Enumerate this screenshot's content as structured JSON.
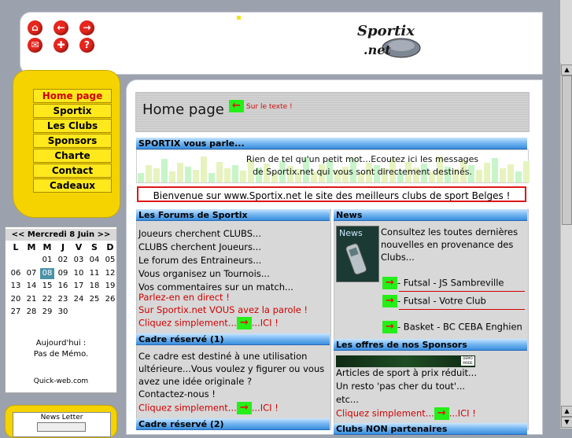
{
  "header": {
    "nav_icons": [
      {
        "name": "home-icon",
        "color": "#e8261d",
        "glyph": "⌂"
      },
      {
        "name": "back-arrow-icon",
        "color": "#e8261d",
        "glyph": "←"
      },
      {
        "name": "forward-arrow-icon",
        "color": "#e8261d",
        "glyph": "→"
      },
      {
        "name": "mail-icon",
        "color": "#e8261d",
        "glyph": "✉"
      },
      {
        "name": "gift-icon",
        "color": "#e8261d",
        "glyph": "✚"
      },
      {
        "name": "help-icon",
        "color": "#e8261d",
        "glyph": "?"
      }
    ],
    "logo_text_top": "Sportix",
    "logo_text_bottom": ".net"
  },
  "menu": {
    "items": [
      "Home page",
      "Sportix",
      "Les Clubs",
      "Sponsors",
      "Charte",
      "Contact",
      "Cadeaux"
    ],
    "active": "Home page"
  },
  "calendar": {
    "title": "<< Mercredi 8 Juin >>",
    "weekdays": [
      "L",
      "M",
      "M",
      "J",
      "V",
      "S",
      "D"
    ],
    "weeks": [
      [
        "",
        "",
        "01",
        "02",
        "03",
        "04",
        "05"
      ],
      [
        "06",
        "07",
        "08",
        "09",
        "10",
        "11",
        "12"
      ],
      [
        "13",
        "14",
        "15",
        "16",
        "17",
        "18",
        "19"
      ],
      [
        "20",
        "21",
        "22",
        "23",
        "24",
        "25",
        "26"
      ],
      [
        "27",
        "28",
        "29",
        "30",
        "",
        "",
        ""
      ]
    ],
    "today": "08",
    "memo_line1": "Aujourd'hui :",
    "memo_line2": "Pas de Mémo.",
    "credit": "Quick-web.com"
  },
  "newsletter": {
    "title": "News Letter"
  },
  "page": {
    "title": "Home page",
    "title_link": "Sur le texte !"
  },
  "sportix_box": {
    "header": "SPORTIX vous parle...",
    "text": "Rien de tel qu'un petit mot...Ecoutez ici les messages de Sportix.net qui vous sont directement destinés."
  },
  "welcome": "Bienvenue sur www.Sportix.net le site des meilleurs clubs de sport Belges !",
  "forums": {
    "header": "Les Forums de Sportix",
    "lines": [
      "Joueurs cherchent CLUBS...",
      "CLUBS cherchent Joueurs...",
      "Le forum des Entraineurs...",
      "Vous organisez un Tournois...",
      "Vos commentaires sur un match..."
    ],
    "red_lines": [
      "Parlez-en en direct !",
      "Sur Sportix.net VOUS avez la parole !"
    ],
    "click_before": "Cliquez simplement...",
    "click_after": "...ICI !"
  },
  "cadre1": {
    "header": "Cadre réservé (1)",
    "lines": [
      "Ce cadre est destiné à une utilisation",
      "ultérieure...Vous voulez y figurer ou vous",
      "avez une idée originale ?",
      "Contactez-nous !"
    ],
    "click_before": "Cliquez simplement...",
    "click_after": "...ICI !"
  },
  "cadre2": {
    "header": "Cadre réservé (2)"
  },
  "news": {
    "header": "News",
    "thumb_label": "News",
    "text_lines": [
      "Consultez les toutes dernières",
      "nouvelles en provenance des",
      "Clubs..."
    ],
    "items": [
      "- Futsal - JS Sambreville",
      "- Futsal - Votre Club",
      "- Basket - BC CEBA Enghien"
    ]
  },
  "sponsors": {
    "header": "Les offres de nos Sponsors",
    "banner_tag": "DEMO MODE",
    "lines": [
      "Articles de sport à prix réduit...",
      "Un resto 'pas cher du tout'...",
      "etc..."
    ],
    "click_before": "Cliquez simplement...",
    "click_after": "...ICI !"
  },
  "clubs_partial": {
    "header": "Clubs NON partenaires"
  }
}
